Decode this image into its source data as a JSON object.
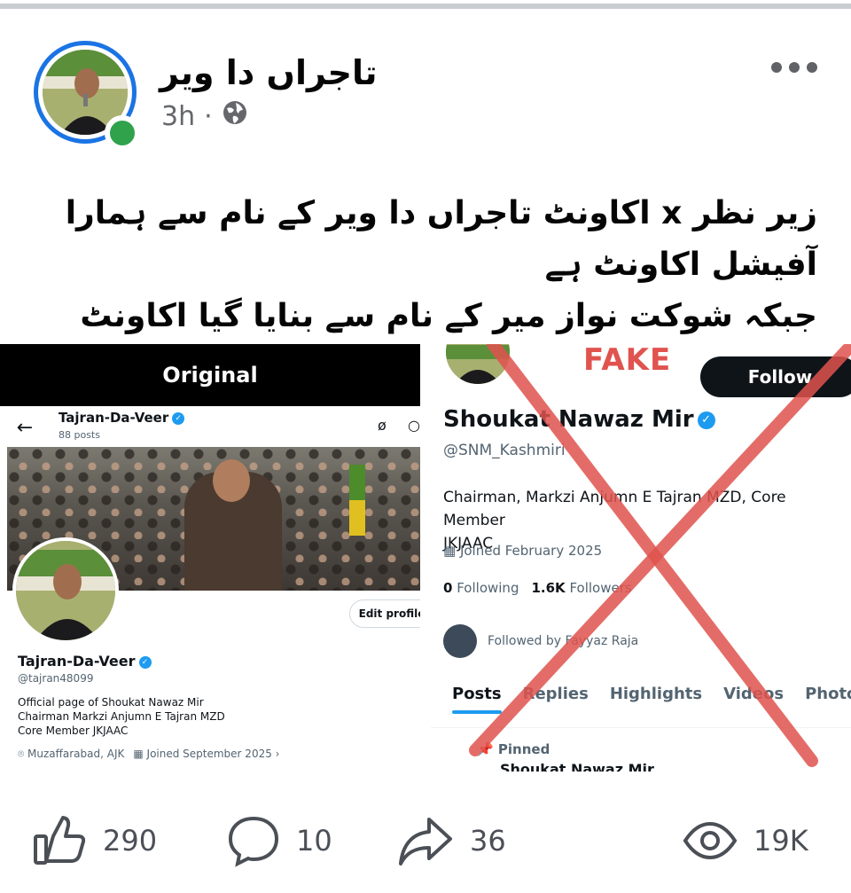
{
  "post": {
    "author": "تاجراں دا ویر",
    "time": "3h",
    "separator": "·",
    "text_line1": "زیر نظر x  اکاونٹ تاجراں دا ویر کے نام سے ہمارا آفیشل اکاونٹ ہے",
    "text_line2": "جبکہ شوکت نواز میر کے نام سے بنایا گیا اکاونٹ  فیک ہے"
  },
  "left_image": {
    "header_label": "Original",
    "top_name": "Tajran-Da-Veer",
    "top_posts": "88 posts",
    "edit_profile": "Edit profile",
    "name": "Tajran-Da-Veer",
    "handle": "@tajran48099",
    "bio_line1": "Official page of Shoukat Nawaz Mir",
    "bio_line2": "Chairman Markzi Anjumn E Tajran MZD",
    "bio_line3": "Core Member JKJAAC",
    "location": "Muzaffarabad, AJK",
    "joined": "Joined September 2025"
  },
  "right_image": {
    "fake_label": "FAKE",
    "follow": "Follow",
    "name": "Shoukat Nawaz Mir",
    "handle": "@SNM_Kashmiri",
    "bio_line1": "Chairman, Markzi Anjumn E Tajran MZD, Core Member",
    "bio_line2": "JKJAAC",
    "joined": "Joined February 2025",
    "following_count": "0",
    "following_label": "Following",
    "followers_count": "1.6K",
    "followers_label": "Followers",
    "followed_by": "Followed by Fayyaz Raja",
    "tabs": [
      "Posts",
      "Replies",
      "Highlights",
      "Videos",
      "Photos"
    ],
    "pinned": "Pinned",
    "pinned_author": "Shoukat Nawaz Mir"
  },
  "actions": {
    "likes": "290",
    "comments": "10",
    "shares": "36",
    "views": "19K"
  },
  "icons": {
    "more": "more-icon",
    "globe": "globe-icon",
    "like": "thumbs-up-icon",
    "comment": "comment-icon",
    "share": "share-icon",
    "views": "eye-icon"
  },
  "colors": {
    "accent": "#1b74e4",
    "online": "#31a24c",
    "fake_red": "#e0534e",
    "x_blue": "#1d9bf0"
  }
}
